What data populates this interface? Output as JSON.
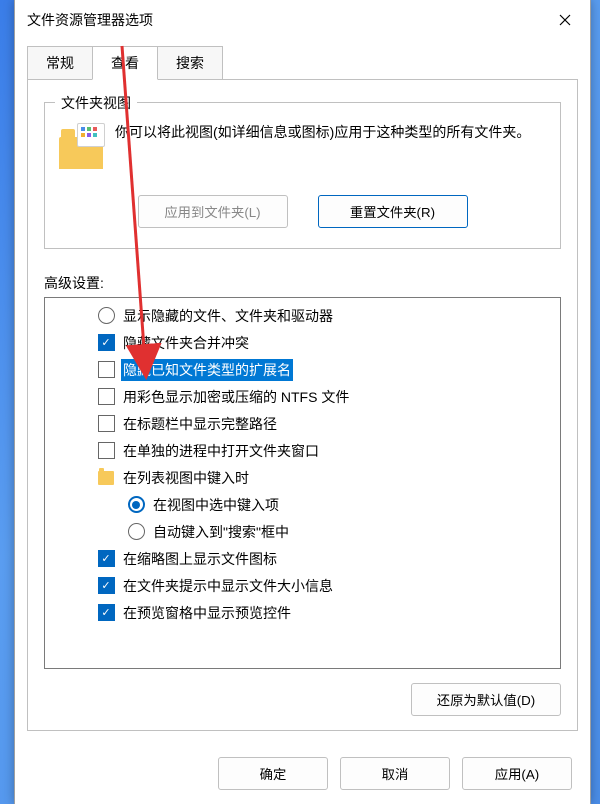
{
  "title": "文件资源管理器选项",
  "tabs": {
    "general": "常规",
    "view": "查看",
    "search": "搜索"
  },
  "folderView": {
    "groupTitle": "文件夹视图",
    "desc": "你可以将此视图(如详细信息或图标)应用于这种类型的所有文件夹。",
    "applyBtn": "应用到文件夹(L)",
    "resetBtn": "重置文件夹(R)"
  },
  "advancedLabel": "高级设置:",
  "items": [
    {
      "type": "radio",
      "indent": false,
      "checked": false,
      "label": "显示隐藏的文件、文件夹和驱动器"
    },
    {
      "type": "checkbox",
      "indent": false,
      "checked": true,
      "label": "隐藏文件夹合并冲突"
    },
    {
      "type": "checkbox",
      "indent": false,
      "checked": false,
      "label": "隐藏已知文件类型的扩展名",
      "highlight": true
    },
    {
      "type": "checkbox",
      "indent": false,
      "checked": false,
      "label": "用彩色显示加密或压缩的 NTFS 文件"
    },
    {
      "type": "checkbox",
      "indent": false,
      "checked": false,
      "label": "在标题栏中显示完整路径"
    },
    {
      "type": "checkbox",
      "indent": false,
      "checked": false,
      "label": "在单独的进程中打开文件夹窗口"
    },
    {
      "type": "folder",
      "indent": false,
      "checked": false,
      "label": "在列表视图中键入时"
    },
    {
      "type": "radio",
      "indent": true,
      "checked": true,
      "label": "在视图中选中键入项"
    },
    {
      "type": "radio",
      "indent": true,
      "checked": false,
      "label": "自动键入到\"搜索\"框中"
    },
    {
      "type": "checkbox",
      "indent": false,
      "checked": true,
      "label": "在缩略图上显示文件图标"
    },
    {
      "type": "checkbox",
      "indent": false,
      "checked": true,
      "label": "在文件夹提示中显示文件大小信息"
    },
    {
      "type": "checkbox",
      "indent": false,
      "checked": true,
      "label": "在预览窗格中显示预览控件"
    }
  ],
  "restoreBtn": "还原为默认值(D)",
  "footer": {
    "ok": "确定",
    "cancel": "取消",
    "apply": "应用(A)"
  }
}
